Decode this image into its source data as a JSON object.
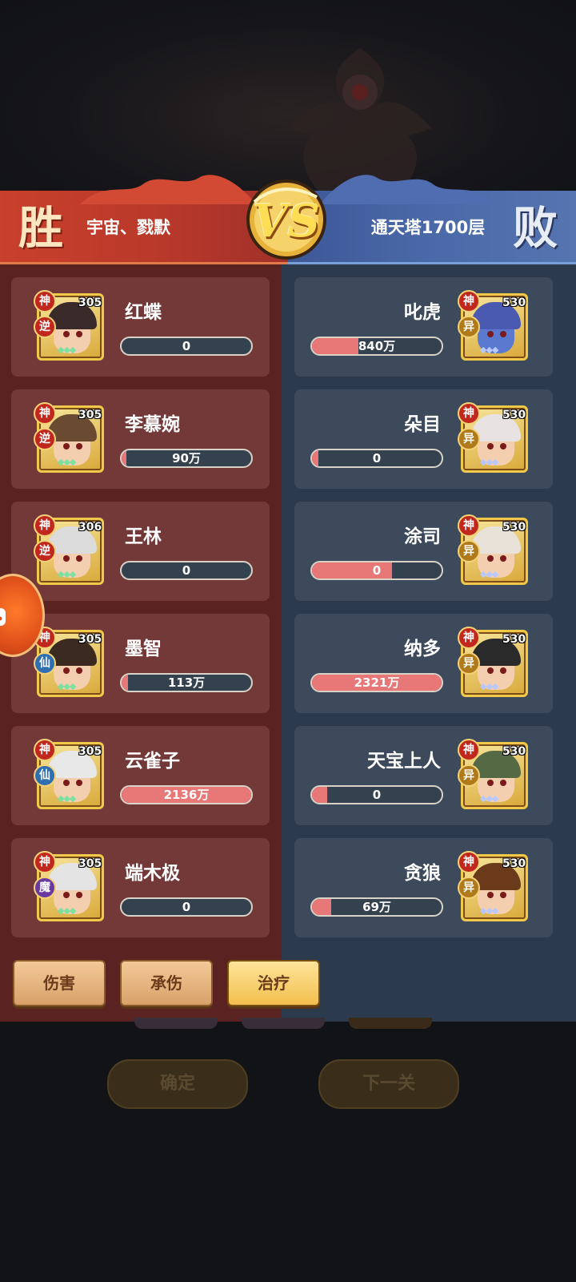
{
  "header": {
    "win_glyph": "胜",
    "lose_glyph": "败",
    "vs_label": "VS",
    "winner_name": "宇宙、戮默",
    "loser_name": "通天塔1700层"
  },
  "left_team": [
    {
      "name": "红蝶",
      "level": "305",
      "rank_badge": "神",
      "type_badge": "逆",
      "value_label": "0",
      "bar_fill": 0
    },
    {
      "name": "李慕婉",
      "level": "305",
      "rank_badge": "神",
      "type_badge": "逆",
      "value_label": "90万",
      "bar_fill": 0.04
    },
    {
      "name": "王林",
      "level": "306",
      "rank_badge": "神",
      "type_badge": "逆",
      "value_label": "0",
      "bar_fill": 0
    },
    {
      "name": "墨智",
      "level": "305",
      "rank_badge": "神",
      "type_badge": "仙",
      "value_label": "113万",
      "bar_fill": 0.05
    },
    {
      "name": "云雀子",
      "level": "305",
      "rank_badge": "神",
      "type_badge": "仙",
      "value_label": "2136万",
      "bar_fill": 1.0
    },
    {
      "name": "端木极",
      "level": "305",
      "rank_badge": "神",
      "type_badge": "魔",
      "value_label": "0",
      "bar_fill": 0
    }
  ],
  "right_team": [
    {
      "name": "叱虎",
      "level": "530",
      "rank_badge": "神",
      "type_badge": "异",
      "value_label": "840万",
      "bar_fill": 0.36
    },
    {
      "name": "朵目",
      "level": "530",
      "rank_badge": "神",
      "type_badge": "异",
      "value_label": "0",
      "bar_fill": 0.05
    },
    {
      "name": "涂司",
      "level": "530",
      "rank_badge": "神",
      "type_badge": "异",
      "value_label": "0",
      "bar_fill": 0.62
    },
    {
      "name": "纳多",
      "level": "530",
      "rank_badge": "神",
      "type_badge": "异",
      "value_label": "2321万",
      "bar_fill": 1.0
    },
    {
      "name": "天宝上人",
      "level": "530",
      "rank_badge": "神",
      "type_badge": "异",
      "value_label": "0",
      "bar_fill": 0.12
    },
    {
      "name": "贪狼",
      "level": "530",
      "rank_badge": "神",
      "type_badge": "异",
      "value_label": "69万",
      "bar_fill": 0.15
    }
  ],
  "tabs": {
    "damage": "伤害",
    "taken": "承伤",
    "heal": "治疗",
    "active": "heal"
  },
  "footer": {
    "confirm": "确定",
    "next": "下一关"
  },
  "colors": {
    "win_red": "#c9402c",
    "lose_blue": "#4b69a8",
    "bar_fill": "#e87877",
    "gold": "#f1c94a"
  },
  "icons": {
    "side_button": "gamepad-icon"
  }
}
